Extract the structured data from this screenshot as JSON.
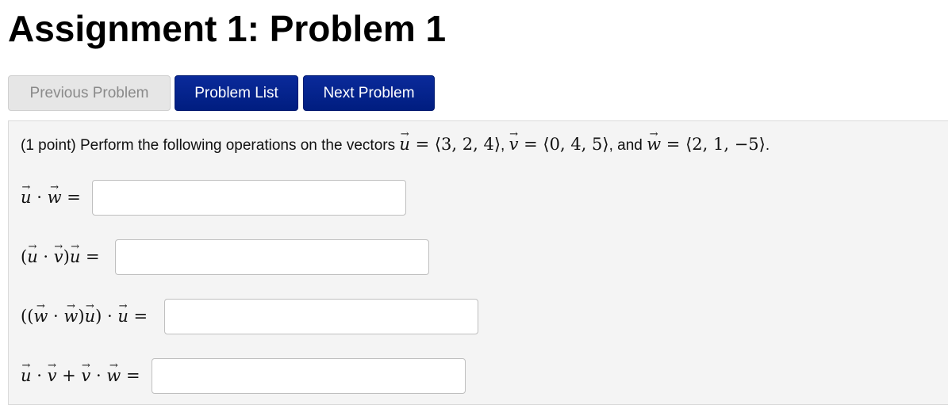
{
  "page": {
    "title": "Assignment 1: Problem 1"
  },
  "nav": {
    "previous_label": "Previous Problem",
    "list_label": "Problem List",
    "next_label": "Next Problem"
  },
  "problem": {
    "points": "(1 point)",
    "intro": "Perform the following operations on the vectors",
    "u_value": "⟨3, 2, 4⟩",
    "v_value": "⟨0, 4, 5⟩",
    "w_value": "⟨2, 1, −5⟩",
    "and_word": "and",
    "questions": [
      {
        "label": "u · w =",
        "value": ""
      },
      {
        "label": "(u · v)u =",
        "value": ""
      },
      {
        "label": "((w · w)u) · u =",
        "value": ""
      },
      {
        "label": "u · v + v · w =",
        "value": ""
      }
    ]
  },
  "colors": {
    "primary_button": "#001d80",
    "disabled_button": "#e6e6e6",
    "panel_background": "#f4f4f4"
  }
}
